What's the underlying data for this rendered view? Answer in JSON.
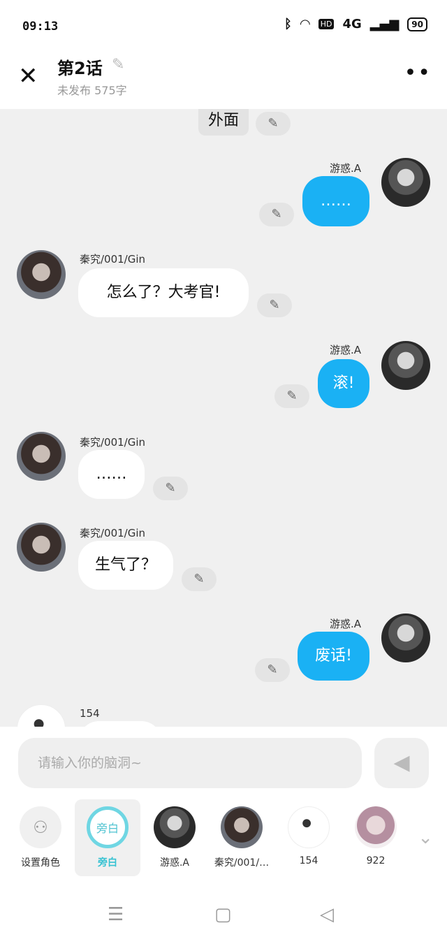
{
  "status": {
    "time": "09:13",
    "network": "4G",
    "hd": "HD",
    "battery": "90"
  },
  "header": {
    "title": "第2话",
    "subtitle": "未发布 575字"
  },
  "chat": {
    "narration_tail": "外面",
    "messages": [
      {
        "speaker": "游惑.A",
        "text": "……",
        "side": "right"
      },
      {
        "speaker": "秦究/001/Gin",
        "text": "怎么了？大考官!",
        "side": "left"
      },
      {
        "speaker": "游惑.A",
        "text": "滚!",
        "side": "right"
      },
      {
        "speaker": "秦究/001/Gin",
        "text": "……",
        "side": "left"
      },
      {
        "speaker": "秦究/001/Gin",
        "text": "生气了？",
        "side": "left"
      },
      {
        "speaker": "游惑.A",
        "text": "废话!",
        "side": "right"
      },
      {
        "speaker": "154",
        "text": "",
        "side": "left"
      }
    ]
  },
  "composer": {
    "placeholder": "请输入你的脑洞~"
  },
  "roles": [
    {
      "label": "设置角色"
    },
    {
      "label": "旁白",
      "avatar_text": "旁白"
    },
    {
      "label": "游惑.A"
    },
    {
      "label": "秦究/001/…"
    },
    {
      "label": "154"
    },
    {
      "label": "922"
    }
  ],
  "icons": {
    "edit": "pencil-icon",
    "close": "close-icon",
    "more": "more-icon",
    "send": "send-icon",
    "expand": "chevron-down-icon"
  },
  "colors": {
    "bubble_blue": "#1ab1f4",
    "narrator_accent": "#37c2d2"
  }
}
